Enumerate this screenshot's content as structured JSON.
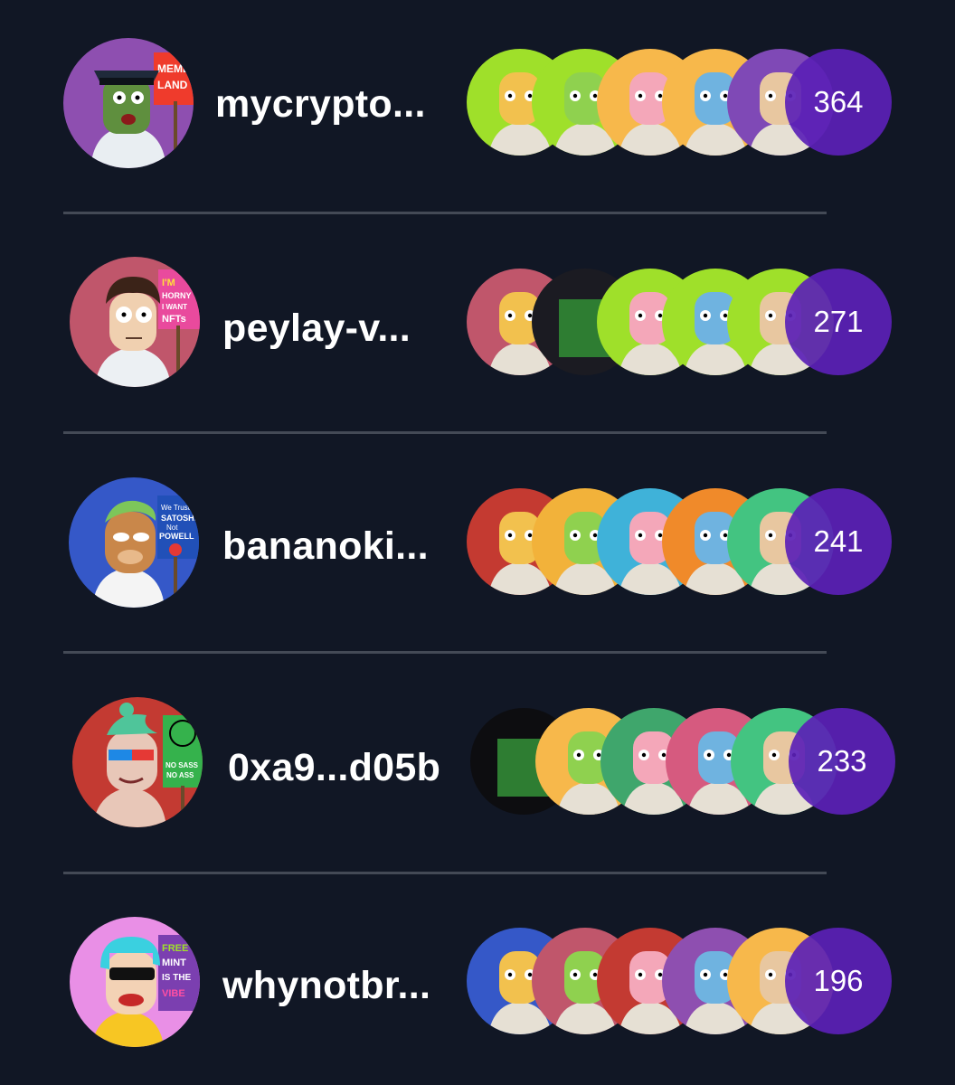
{
  "leaderboard": {
    "rows": [
      {
        "username": "mycrypto...",
        "count": "364",
        "avatar": {
          "bg": "#8e4fb0",
          "skin": "#5f8f3e",
          "sign_bg": "#ef3b2c",
          "sign_text": "MEME LAND",
          "hat": "#1f2a3a"
        },
        "nfts": [
          "#9fe02a",
          "#9fe02a",
          "#f7b84b",
          "#f7b84b",
          "#7f49b6"
        ]
      },
      {
        "username": "peylay-v...",
        "count": "271",
        "avatar": {
          "bg": "#c0566b",
          "skin": "#f0d0b0",
          "sign_bg": "#e94a9d",
          "sign_text": "I'M HORNY I WANT NFTs",
          "hat": "#3b2318"
        },
        "nfts": [
          "#c0566b",
          "#1b1b22",
          "#9fe02a",
          "#9fe02a",
          "#9fe02a"
        ]
      },
      {
        "username": "bananoki...",
        "count": "241",
        "avatar": {
          "bg": "#3558c8",
          "skin": "#c9874a",
          "sign_bg": "#2150b8",
          "sign_text": "We Trust SATOSHI Not POWELL",
          "hat": "#7dc65a"
        },
        "nfts": [
          "#c43a31",
          "#f2b23a",
          "#3fb2d9",
          "#f08a2a",
          "#43c481"
        ]
      },
      {
        "username": "0xa9...d05b",
        "count": "233",
        "avatar": {
          "bg": "#c33a32",
          "skin": "#e8c7b8",
          "sign_bg": "#35b24c",
          "sign_text": "NO SASS NO ASS",
          "hat": "#4fc59a"
        },
        "nfts": [
          "#0d0d10",
          "#f7b84b",
          "#3fa66c",
          "#d65a7f",
          "#43c481"
        ]
      },
      {
        "username": "whynotbr...",
        "count": "196",
        "avatar": {
          "bg": "#e98fe6",
          "skin": "#f3d2b5",
          "sign_bg": "#7b3fb0",
          "sign_text": "FREE MINT IS THE VIBE",
          "hat": "#3ad0e0"
        },
        "nfts": [
          "#3558c8",
          "#c0566b",
          "#c33a32",
          "#8e4fb0",
          "#f7b84b"
        ]
      }
    ]
  }
}
